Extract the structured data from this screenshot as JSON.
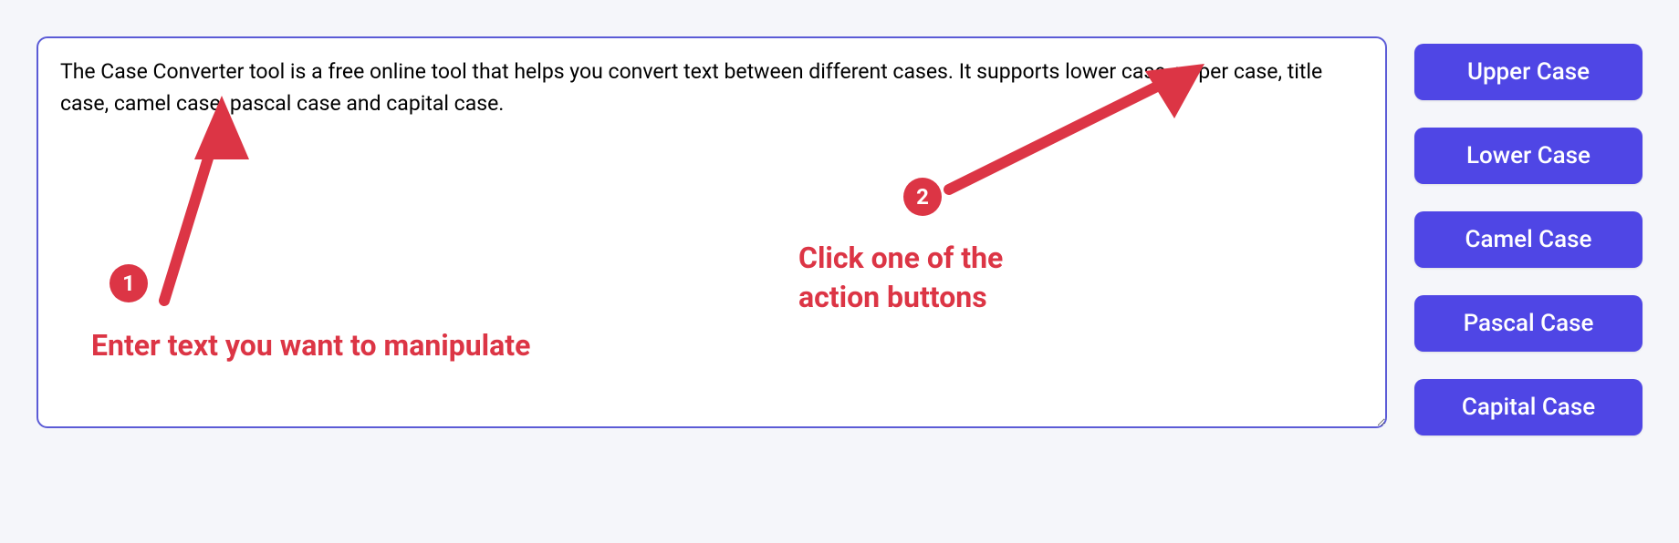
{
  "textarea": {
    "value": "The Case Converter tool is a free online tool that helps you convert text between different cases. It supports lower case, upper case, title case, camel case, pascal case and capital case. "
  },
  "buttons": {
    "upper": "Upper Case",
    "lower": "Lower Case",
    "camel": "Camel Case",
    "pascal": "Pascal Case",
    "capital": "Capital Case"
  },
  "annotations": {
    "badge1": "1",
    "badge2": "2",
    "text1": "Enter text you want to manipulate",
    "text2": "Click one of the\naction buttons"
  },
  "colors": {
    "accent": "#4f46e5",
    "annotation": "#dc3545"
  }
}
